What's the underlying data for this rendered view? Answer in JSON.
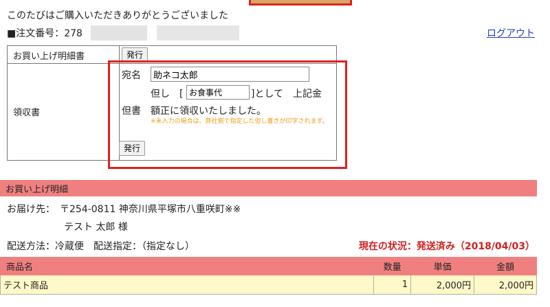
{
  "header": {
    "thanks": "このたびはご購入いただきありがとうございました",
    "order_prefix": "■注文番号：278",
    "logout": "ログアウト"
  },
  "receipt_table": {
    "statement_label": "お買い上げ明細書",
    "statement_button": "発行",
    "receipt_label": "領収書",
    "addressee_label": "宛名",
    "addressee_value": "助ネコ太郎",
    "proviso_label": "但書",
    "proviso_prefix": "但し　[",
    "proviso_value": "お食事代",
    "proviso_suffix": "]として　上記金",
    "proviso_line2": "額正に領収いたしました。",
    "note": "※未入力の場合は、弊社側で指定した但し書きが印字されます。",
    "issue_button": "発行"
  },
  "details": {
    "section_title": "お買い上げ明細",
    "address": "お届け先：　〒254-0811 神奈川県平塚市八重咲町※※",
    "recipient": "テスト 太郎 様",
    "shipping": "配送方法：冷蔵便　配送指定：（指定なし）",
    "status": "現在の状況：発送済み（2018/04/03）",
    "columns": [
      "商品名",
      "数量",
      "単価",
      "金額"
    ],
    "rows": [
      {
        "name": "テスト商品",
        "qty": "1",
        "unit_price": "2,000円",
        "amount": "2,000円"
      }
    ]
  }
}
